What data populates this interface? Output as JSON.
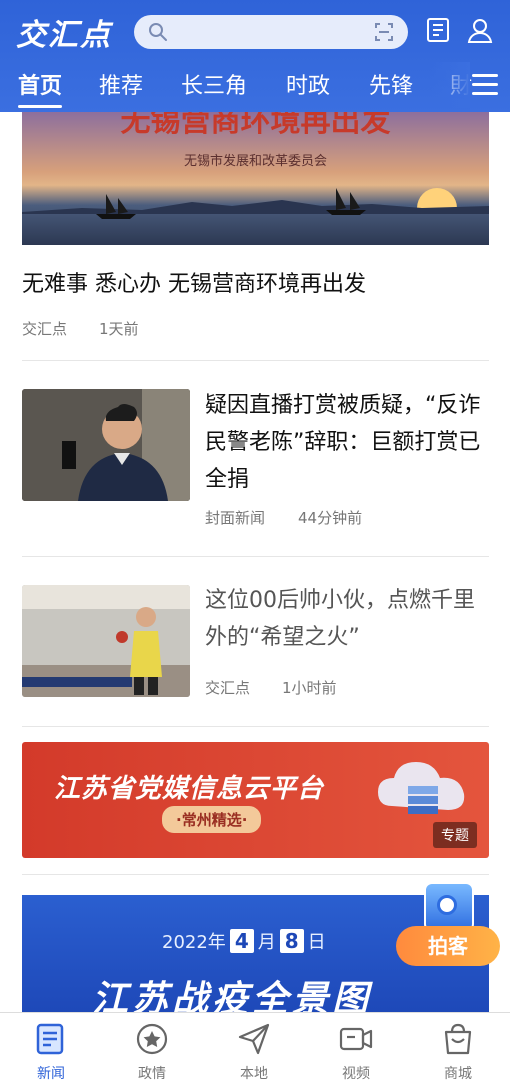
{
  "header": {
    "logo": "交汇点",
    "search": {
      "placeholder": ""
    },
    "icons": [
      "newspaper-icon",
      "user-icon"
    ]
  },
  "tabs": [
    {
      "label": "首页",
      "active": true
    },
    {
      "label": "推荐"
    },
    {
      "label": "长三角"
    },
    {
      "label": "时政"
    },
    {
      "label": "先锋"
    },
    {
      "label": "財"
    }
  ],
  "hero": {
    "title": "无锡营商环境再出发",
    "subtitle": "无锡市发展和改革委员会",
    "article_title": "无难事  悉心办  无锡营商环境再出发",
    "source": "交汇点",
    "time": "1天前"
  },
  "articles": [
    {
      "title": "疑因直播打赏被质疑，“反诈民警老陈”辞职：巨额打赏已全捐",
      "source": "封面新闻",
      "time": "44分钟前"
    },
    {
      "title": "这位00后帅小伙，点燃千里外的“希望之火”",
      "source": "交汇点",
      "time": "1小时前"
    }
  ],
  "banner": {
    "title": "江苏省党媒信息云平台",
    "subtitle": "·常州精选·",
    "badge": "专题"
  },
  "banner2": {
    "date_year": "2022年",
    "date_month": "4",
    "month_unit": "月",
    "date_day": "8",
    "day_unit": "日",
    "title": "江苏战疫全景图"
  },
  "paike": {
    "label": "拍客"
  },
  "bottom_nav": [
    {
      "label": "新闻",
      "icon": "news-icon",
      "active": true
    },
    {
      "label": "政情",
      "icon": "star-badge-icon"
    },
    {
      "label": "本地",
      "icon": "send-icon"
    },
    {
      "label": "视频",
      "icon": "video-icon"
    },
    {
      "label": "商城",
      "icon": "shopping-bag-icon"
    }
  ],
  "colors": {
    "brand": "#2f63d8",
    "accent": "#e4553d"
  }
}
